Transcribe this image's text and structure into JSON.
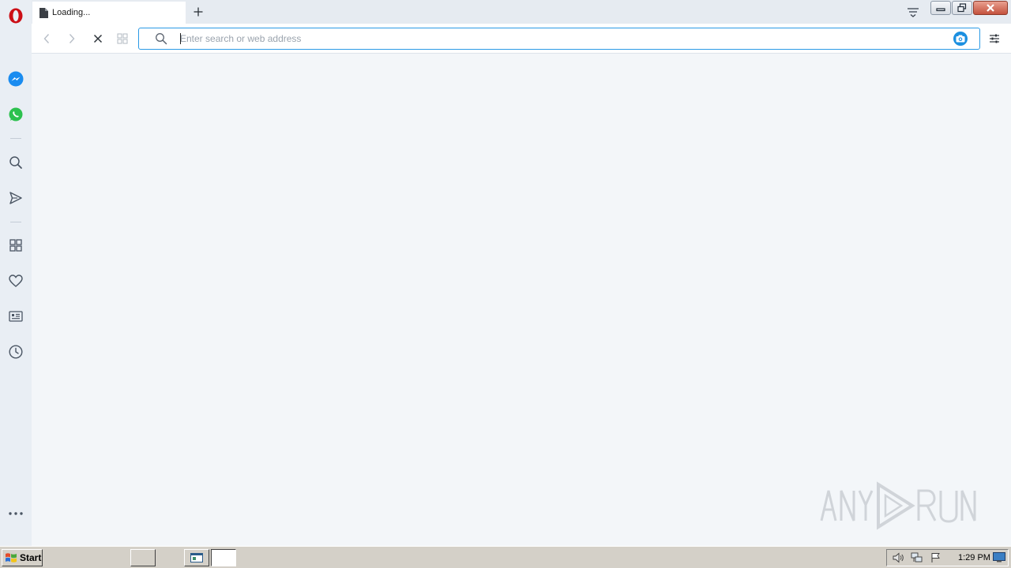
{
  "browser": {
    "tab": {
      "title": "Loading..."
    },
    "address_bar": {
      "placeholder": "Enter search or web address",
      "value": ""
    },
    "accent_color": "#2a9ae6",
    "logo_color": "#cc0f16"
  },
  "sidebar": {
    "items": [
      {
        "name": "messenger-icon"
      },
      {
        "name": "whatsapp-icon"
      },
      {
        "name": "search-icon"
      },
      {
        "name": "send-icon"
      },
      {
        "name": "speed-dial-icon"
      },
      {
        "name": "heart-icon"
      },
      {
        "name": "news-icon"
      },
      {
        "name": "history-icon"
      },
      {
        "name": "more-icon"
      }
    ]
  },
  "watermark": {
    "text": "ANY RUN"
  },
  "taskbar": {
    "start_label": "Start",
    "clock": "1:29 PM"
  }
}
